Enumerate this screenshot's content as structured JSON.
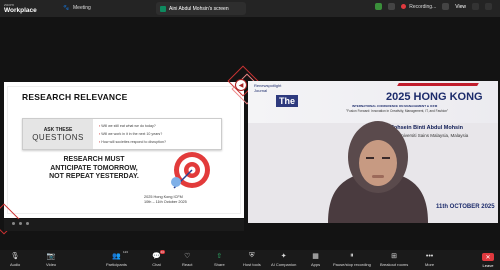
{
  "topbar": {
    "brand_small": "zoom",
    "brand_large": "Workplace",
    "meeting_label": "Meeting",
    "share_label": "Aini Abdul Mohsin's screen",
    "recording_label": "Recording...",
    "view_label": "View"
  },
  "slide": {
    "title": "RESEARCH RELEVANCE",
    "ask_line1": "ASK THESE",
    "ask_line2": "QUESTIONS",
    "questions": [
      "Will we still eat what we do today?",
      "Will we work in it in the next 10 years?",
      "How will societies respond to disruption?"
    ],
    "big_line1": "RESEARCH MUST",
    "big_line2": "ANTICIPATE TOMORROW,",
    "big_line3": "NOT REPEAT YESTERDAY.",
    "foot_line1": "2025 Hong Kong ICFM",
    "foot_line2": "10th – 11th October 2025"
  },
  "video": {
    "top_left_1": "Renewspotlight",
    "top_left_2": "Journal",
    "the": "The",
    "hk_title": "2025 HONG KONG",
    "hk_sub": "INTERNATIONAL CONFERENCE ON MANAGEMENT & ICFM",
    "hk_sub2": "\"Fusion Forward: Innovation in Creativity, Management, IT, and Fashion\"",
    "name": "Ainul Mohsein Binti Abdul Mohsin",
    "affiliation": "Universiti Sains Malaysia, Malaysia",
    "date": "11th OCTOBER 2025"
  },
  "bottombar": {
    "items": [
      {
        "label": "Audio",
        "icon": "microphone-icon"
      },
      {
        "label": "Video",
        "icon": "camera-icon"
      },
      {
        "label": "Participants",
        "icon": "participants-icon",
        "count": "123"
      },
      {
        "label": "Chat",
        "icon": "chat-icon",
        "badge": "46"
      },
      {
        "label": "React",
        "icon": "heart-icon"
      },
      {
        "label": "Share",
        "icon": "share-icon"
      },
      {
        "label": "Host tools",
        "icon": "shield-icon"
      },
      {
        "label": "AI Companion",
        "icon": "sparkle-icon"
      },
      {
        "label": "Apps",
        "icon": "apps-icon"
      },
      {
        "label": "Pause/stop recording",
        "icon": "pause-icon"
      },
      {
        "label": "Breakout rooms",
        "icon": "grid-icon"
      },
      {
        "label": "More",
        "icon": "more-icon"
      }
    ],
    "leave_label": "Leave"
  },
  "colors": {
    "accent_red": "#e0393e",
    "brand_navy": "#1c2b6b",
    "share_green": "#0e8a5f"
  }
}
